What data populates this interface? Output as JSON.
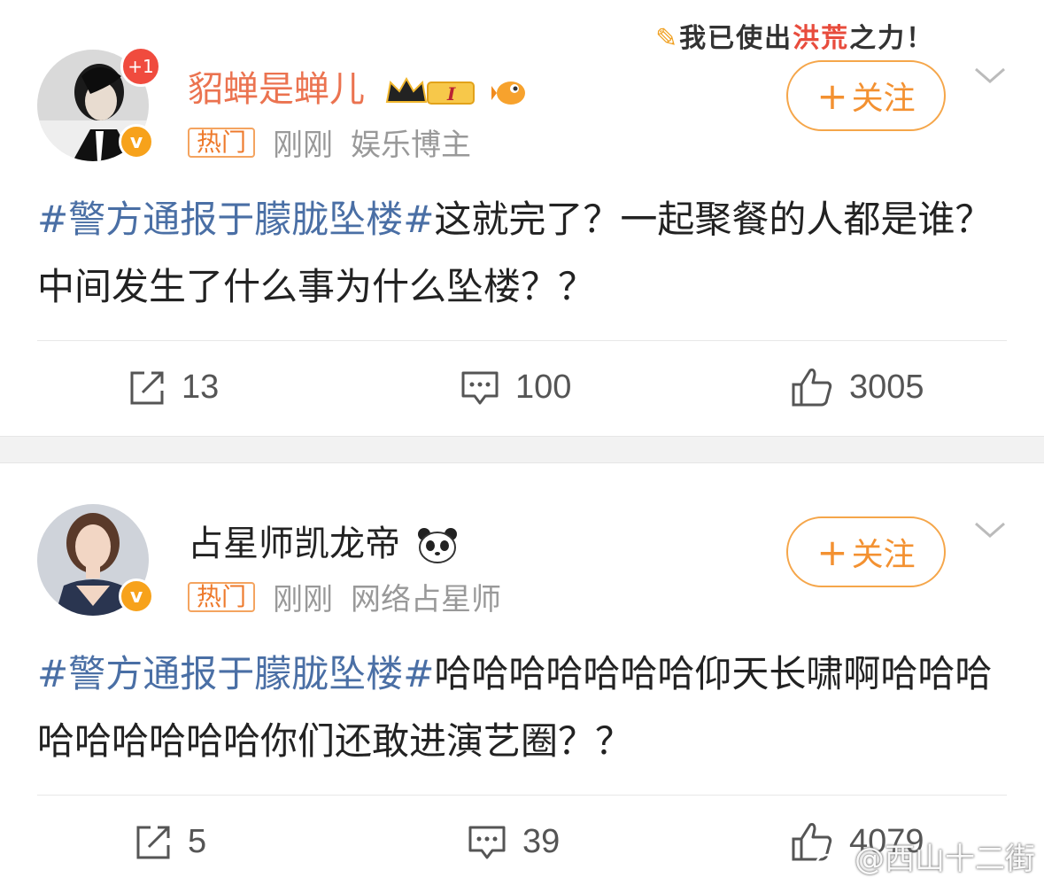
{
  "banner": {
    "prefix": "我已使出",
    "highlight": "洪荒",
    "suffix": "之力！"
  },
  "posts": [
    {
      "username": "貂蝉是蝉儿",
      "notif_count": "+1",
      "verified": "v",
      "hot_label": "热门",
      "time": "刚刚",
      "role": "娱乐博主",
      "follow_label": "关注",
      "follow_plus": "+",
      "rank_badge": "I",
      "topic": "#警方通报于朦胧坠楼#",
      "text": "这就完了？一起聚餐的人都是谁？中间发生了什么事为什么坠楼？？",
      "reposts": "13",
      "comments": "100",
      "likes": "3005"
    },
    {
      "username": "占星师凯龙帝",
      "verified": "v",
      "hot_label": "热门",
      "time": "刚刚",
      "role": "网络占星师",
      "follow_label": "关注",
      "follow_plus": "+",
      "topic": "#警方通报于朦胧坠楼#",
      "text": "哈哈哈哈哈哈哈仰天长啸啊哈哈哈哈哈哈哈哈哈你们还敢进演艺圈？？",
      "reposts": "5",
      "comments": "39",
      "likes": "4079"
    }
  ],
  "watermark": "@西山十二街",
  "colors": {
    "accent_orange": "#eb7350",
    "topic_blue": "#4a6fa5",
    "follow_border": "#f5a64a",
    "verified": "#f7a21b"
  },
  "icons": [
    "repost-icon",
    "comment-icon",
    "like-icon",
    "chevron-down-icon",
    "crown-icon",
    "fish-icon",
    "panda-icon",
    "weibo-logo-icon"
  ]
}
